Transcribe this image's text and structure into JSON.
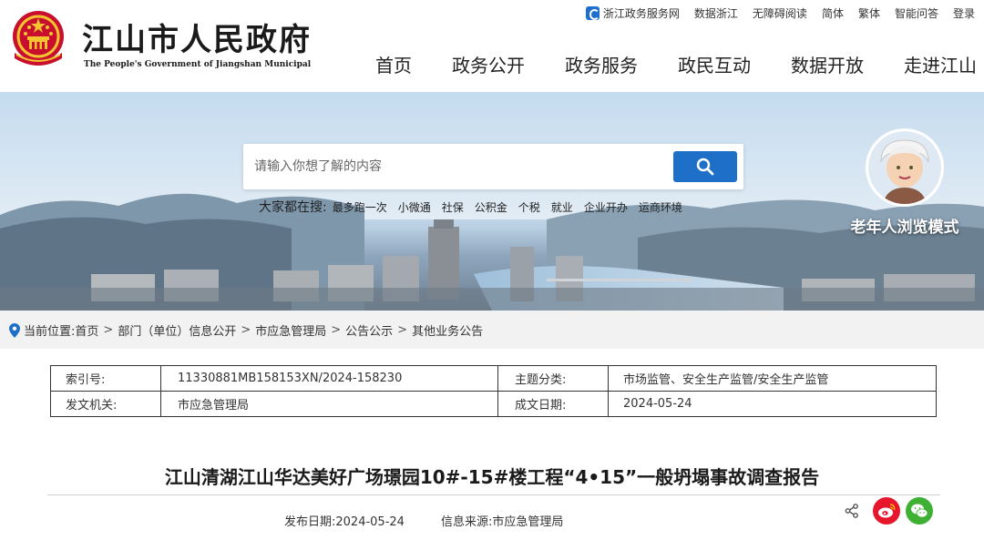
{
  "header": {
    "title": "江山市人民政府",
    "subtitle": "The People's Government of Jiangshan Municipal",
    "emblem_icon": "national-emblem-icon",
    "top_links": [
      "浙江政务服务网",
      "数据浙江",
      "无障碍阅读",
      "简体",
      "繁体",
      "智能问答",
      "登录"
    ],
    "nav": [
      "首页",
      "政务公开",
      "政务服务",
      "政民互动",
      "数据开放",
      "走进江山"
    ]
  },
  "banner": {
    "search_placeholder": "请输入你想了解的内容",
    "search_icon": "search-icon",
    "hot_label": "大家都在搜:",
    "hot_items": [
      "最多跑一次",
      "小微通",
      "社保",
      "公积金",
      "个税",
      "就业",
      "企业开办",
      "运商环境"
    ],
    "elder_mode_label": "老年人浏览模式"
  },
  "breadcrumb": {
    "label": "当前位置:",
    "items": [
      "首页",
      "部门（单位）信息公开",
      "市应急管理局",
      "公告公示",
      "其他业务公告"
    ],
    "separator": ">"
  },
  "meta": {
    "rows": [
      [
        "索引号:",
        "11330881MB158153XN/2024-158230",
        "主题分类:",
        "市场监管、安全生产监管/安全生产监管"
      ],
      [
        "发文机关:",
        "市应急管理局",
        "成文日期:",
        "2024-05-24"
      ]
    ]
  },
  "article": {
    "title": "江山清湖江山华达美好广场璟园10#-15#楼工程“4•15”一般坍塌事故调查报告",
    "publish_label": "发布日期:",
    "publish_date": "2024-05-24",
    "source_label": "信息来源:",
    "source": "市应急管理局"
  },
  "colors": {
    "primary_blue": "#1e6fc7",
    "weibo_red": "#e6162d",
    "wechat_green": "#3eb135",
    "crumb_bg": "#f2f2f2"
  }
}
